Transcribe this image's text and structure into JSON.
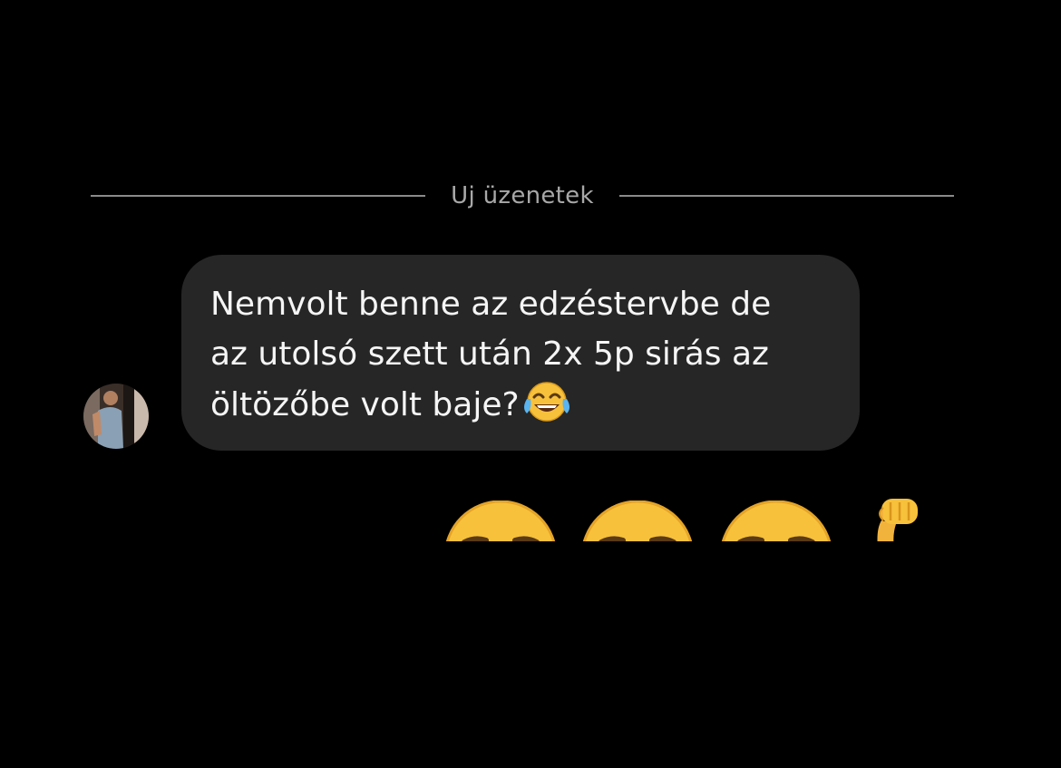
{
  "divider": {
    "label": "Uj üzenetek"
  },
  "message": {
    "text": "Nemvolt benne az edzéstervbe de\naz utolsó szett után 2x 5p sirás az\nöltözőbe volt baje?",
    "trailing_emoji": "face-with-tears-of-joy-icon"
  },
  "reactions": [
    {
      "icon": "emoji-face-icon"
    },
    {
      "icon": "emoji-face-icon"
    },
    {
      "icon": "emoji-face-icon"
    },
    {
      "icon": "flexed-arm-icon"
    }
  ],
  "colors": {
    "background": "#000000",
    "bubble": "#262626",
    "text": "#f5f5f5",
    "divider": "#8a8a8a",
    "emoji_yellow": "#f7c13c"
  }
}
